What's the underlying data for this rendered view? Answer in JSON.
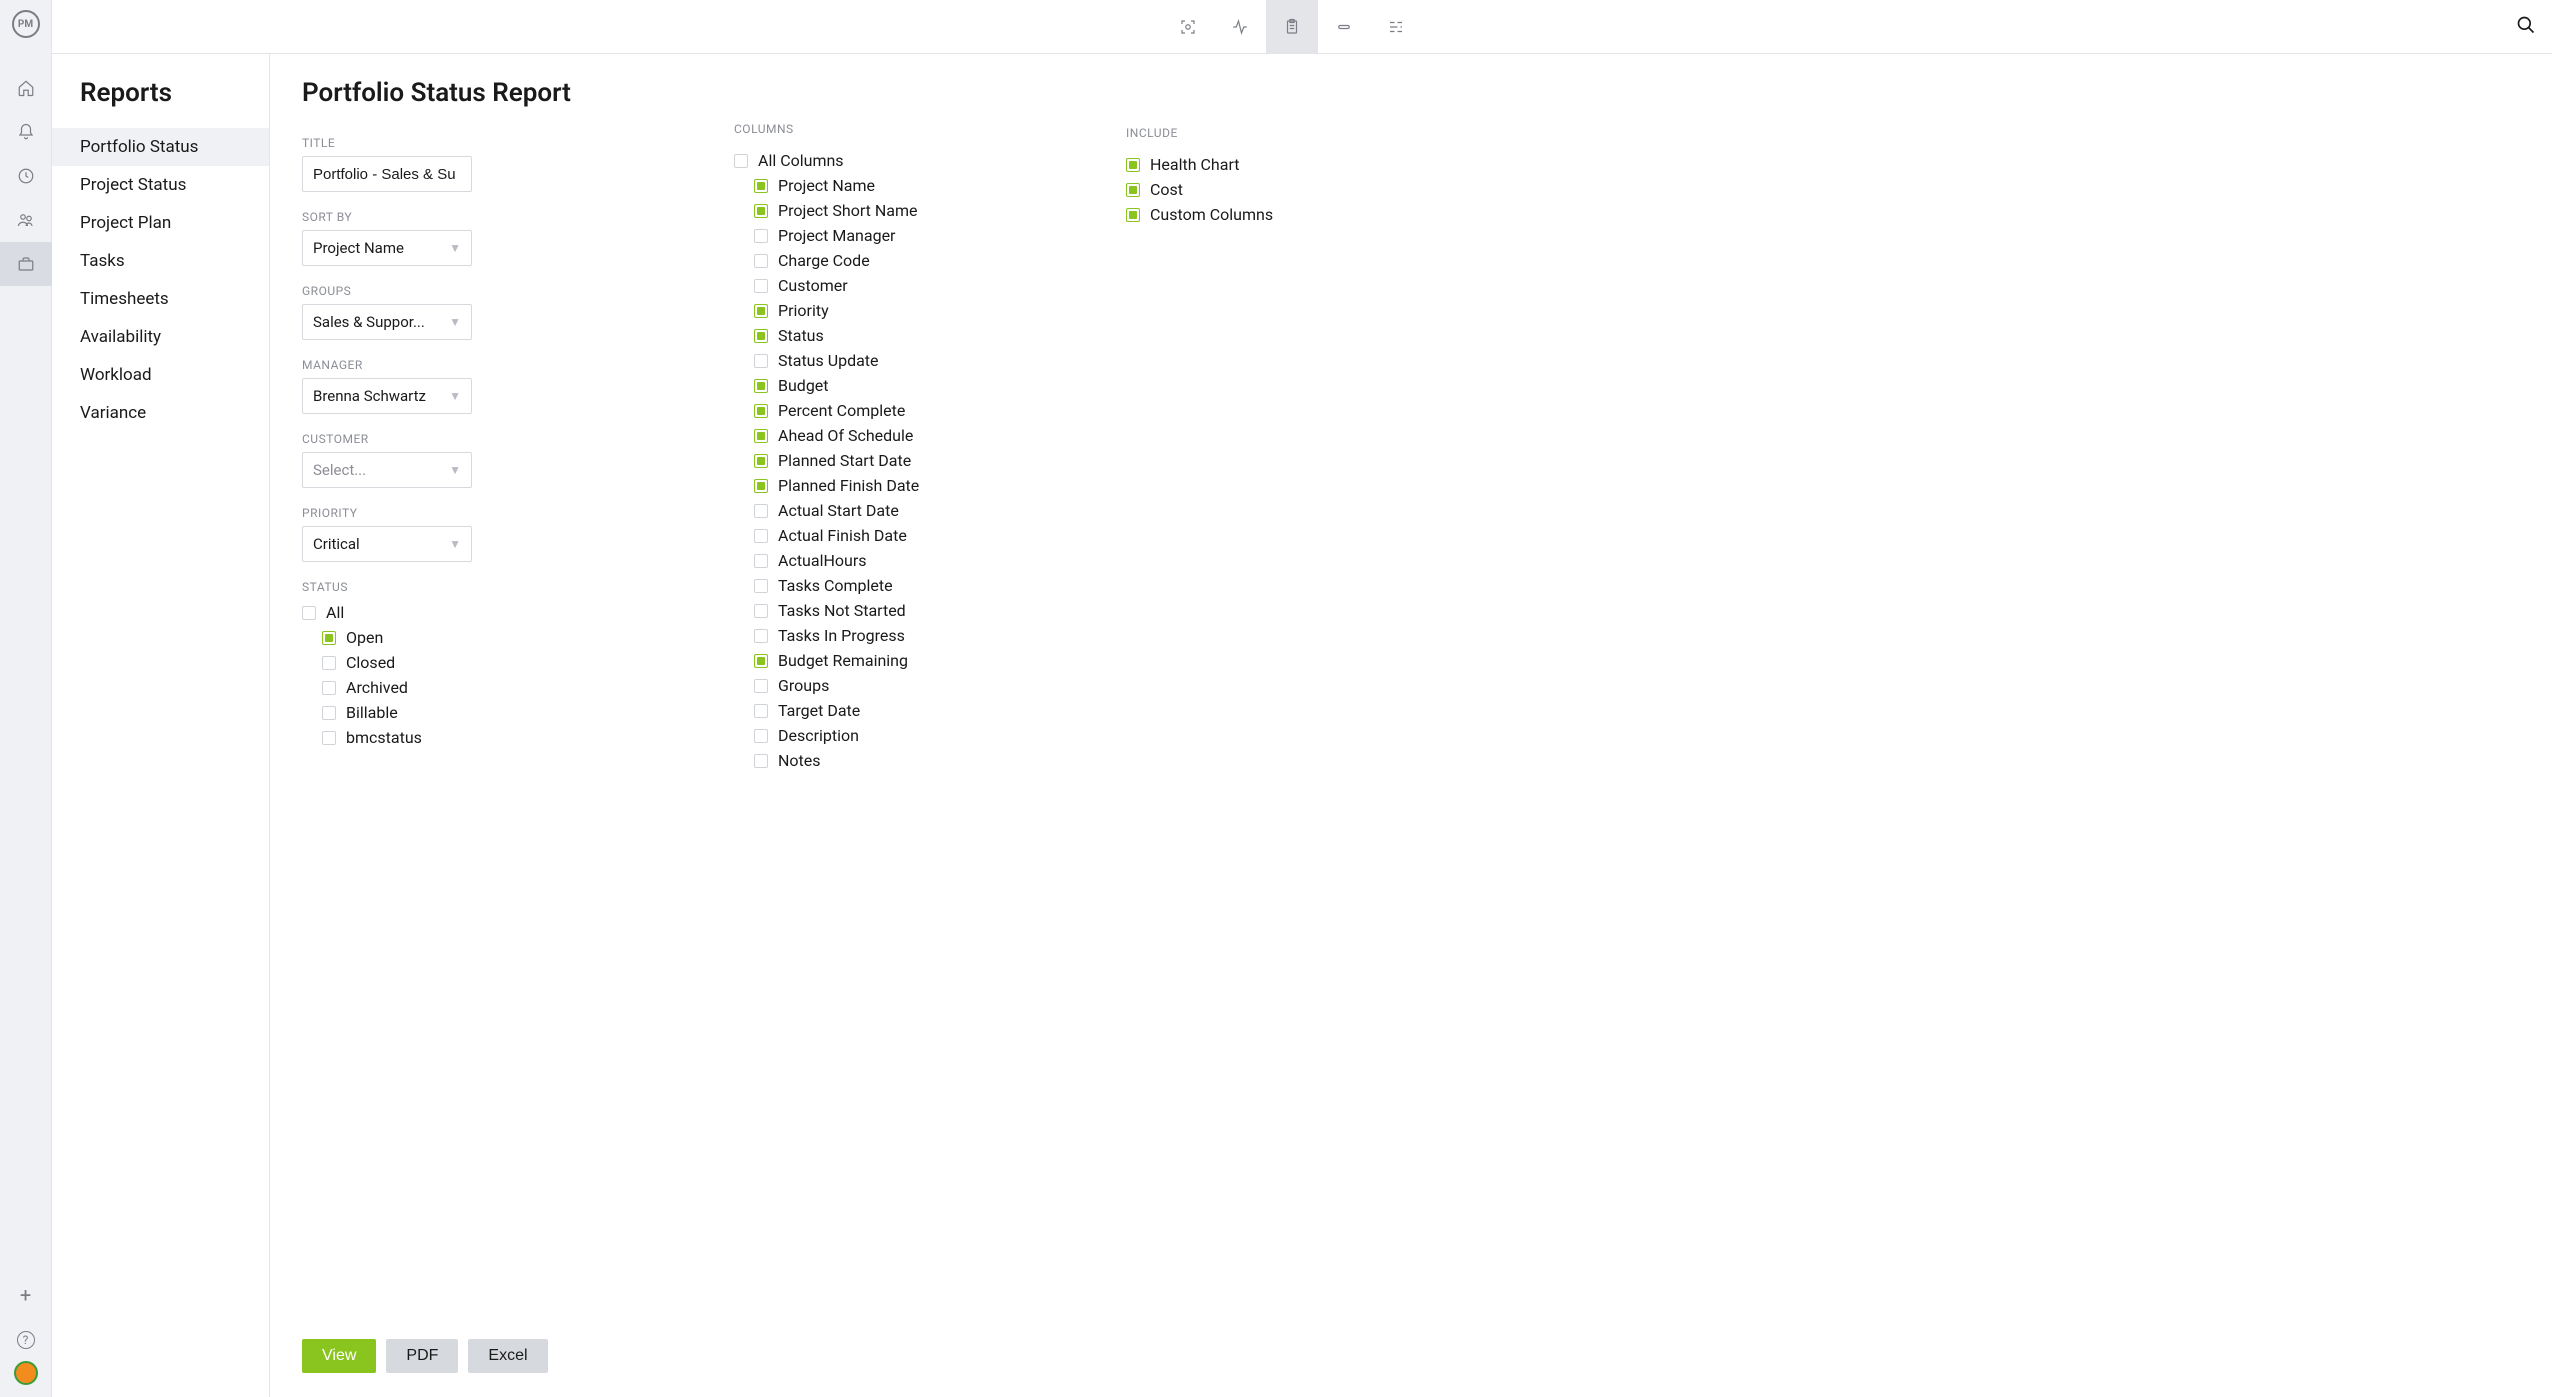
{
  "app_logo": "PM",
  "sidebar": {
    "title": "Reports",
    "items": [
      {
        "label": "Portfolio Status",
        "active": true
      },
      {
        "label": "Project Status"
      },
      {
        "label": "Project Plan"
      },
      {
        "label": "Tasks"
      },
      {
        "label": "Timesheets"
      },
      {
        "label": "Availability"
      },
      {
        "label": "Workload"
      },
      {
        "label": "Variance"
      }
    ]
  },
  "page": {
    "title": "Portfolio Status Report"
  },
  "fields": {
    "title_label": "TITLE",
    "title_value": "Portfolio - Sales & Su",
    "sort_label": "SORT BY",
    "sort_value": "Project Name",
    "groups_label": "GROUPS",
    "groups_value": "Sales & Suppor...",
    "manager_label": "MANAGER",
    "manager_value": "Brenna Schwartz",
    "customer_label": "CUSTOMER",
    "customer_value": "Select...",
    "priority_label": "PRIORITY",
    "priority_value": "Critical"
  },
  "status": {
    "label": "STATUS",
    "items": [
      {
        "label": "All",
        "checked": false,
        "indent": 0
      },
      {
        "label": "Open",
        "checked": true,
        "indent": 1
      },
      {
        "label": "Closed",
        "checked": false,
        "indent": 1
      },
      {
        "label": "Archived",
        "checked": false,
        "indent": 1
      },
      {
        "label": "Billable",
        "checked": false,
        "indent": 1
      },
      {
        "label": "bmcstatus",
        "checked": false,
        "indent": 1
      }
    ]
  },
  "buttons": {
    "view": "View",
    "pdf": "PDF",
    "excel": "Excel"
  },
  "columns": {
    "label": "COLUMNS",
    "all_label": "All Columns",
    "all_checked": false,
    "items": [
      {
        "label": "Project Name",
        "checked": true
      },
      {
        "label": "Project Short Name",
        "checked": true
      },
      {
        "label": "Project Manager",
        "checked": false
      },
      {
        "label": "Charge Code",
        "checked": false
      },
      {
        "label": "Customer",
        "checked": false
      },
      {
        "label": "Priority",
        "checked": true
      },
      {
        "label": "Status",
        "checked": true
      },
      {
        "label": "Status Update",
        "checked": false
      },
      {
        "label": "Budget",
        "checked": true
      },
      {
        "label": "Percent Complete",
        "checked": true
      },
      {
        "label": "Ahead Of Schedule",
        "checked": true
      },
      {
        "label": "Planned Start Date",
        "checked": true
      },
      {
        "label": "Planned Finish Date",
        "checked": true
      },
      {
        "label": "Actual Start Date",
        "checked": false
      },
      {
        "label": "Actual Finish Date",
        "checked": false
      },
      {
        "label": "ActualHours",
        "checked": false
      },
      {
        "label": "Tasks Complete",
        "checked": false
      },
      {
        "label": "Tasks Not Started",
        "checked": false
      },
      {
        "label": "Tasks In Progress",
        "checked": false
      },
      {
        "label": "Budget Remaining",
        "checked": true
      },
      {
        "label": "Groups",
        "checked": false
      },
      {
        "label": "Target Date",
        "checked": false
      },
      {
        "label": "Description",
        "checked": false
      },
      {
        "label": "Notes",
        "checked": false
      }
    ]
  },
  "include": {
    "label": "INCLUDE",
    "items": [
      {
        "label": "Health Chart",
        "checked": true
      },
      {
        "label": "Cost",
        "checked": true
      },
      {
        "label": "Custom Columns",
        "checked": true
      }
    ]
  }
}
